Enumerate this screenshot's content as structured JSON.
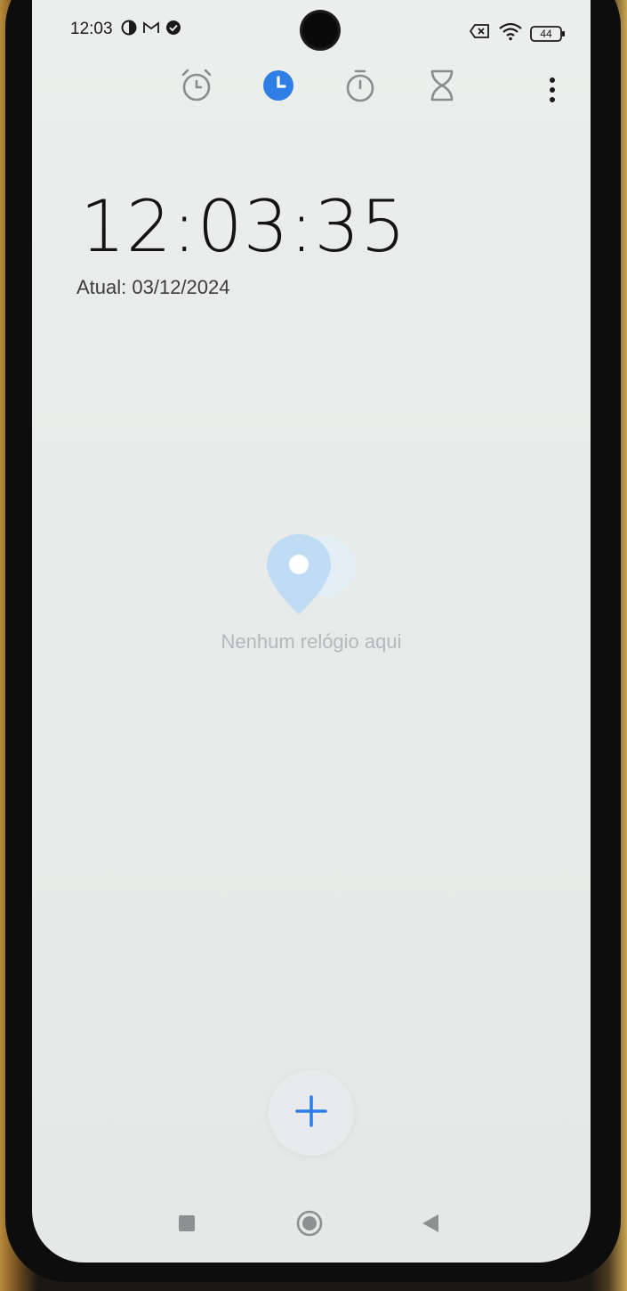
{
  "status_bar": {
    "time": "12:03",
    "battery_level": "44",
    "left_icons": [
      "data-saver-icon",
      "gmail-icon",
      "check-circle-icon"
    ],
    "right_icons": [
      "no-sim-icon",
      "wifi-icon",
      "battery-icon"
    ]
  },
  "tabs": [
    {
      "name": "alarm-tab",
      "icon": "alarm-clock-icon",
      "active": false
    },
    {
      "name": "clock-tab",
      "icon": "clock-icon",
      "active": true
    },
    {
      "name": "stopwatch-tab",
      "icon": "stopwatch-icon",
      "active": false
    },
    {
      "name": "timer-tab",
      "icon": "hourglass-icon",
      "active": false
    }
  ],
  "clock": {
    "time": "12:03:35",
    "date_label": "Atual: 03/12/2024"
  },
  "world_clocks": {
    "empty_message": "Nenhum relógio aqui",
    "empty_icon": "location-pin-icon"
  },
  "add_button": {
    "icon": "plus-icon"
  },
  "navigation": [
    "recents-button",
    "home-button",
    "back-button"
  ],
  "colors": {
    "accent": "#2f7ee6",
    "pin": "#bfdcf4",
    "text_primary": "#141414",
    "text_muted": "#b3b8bb"
  }
}
